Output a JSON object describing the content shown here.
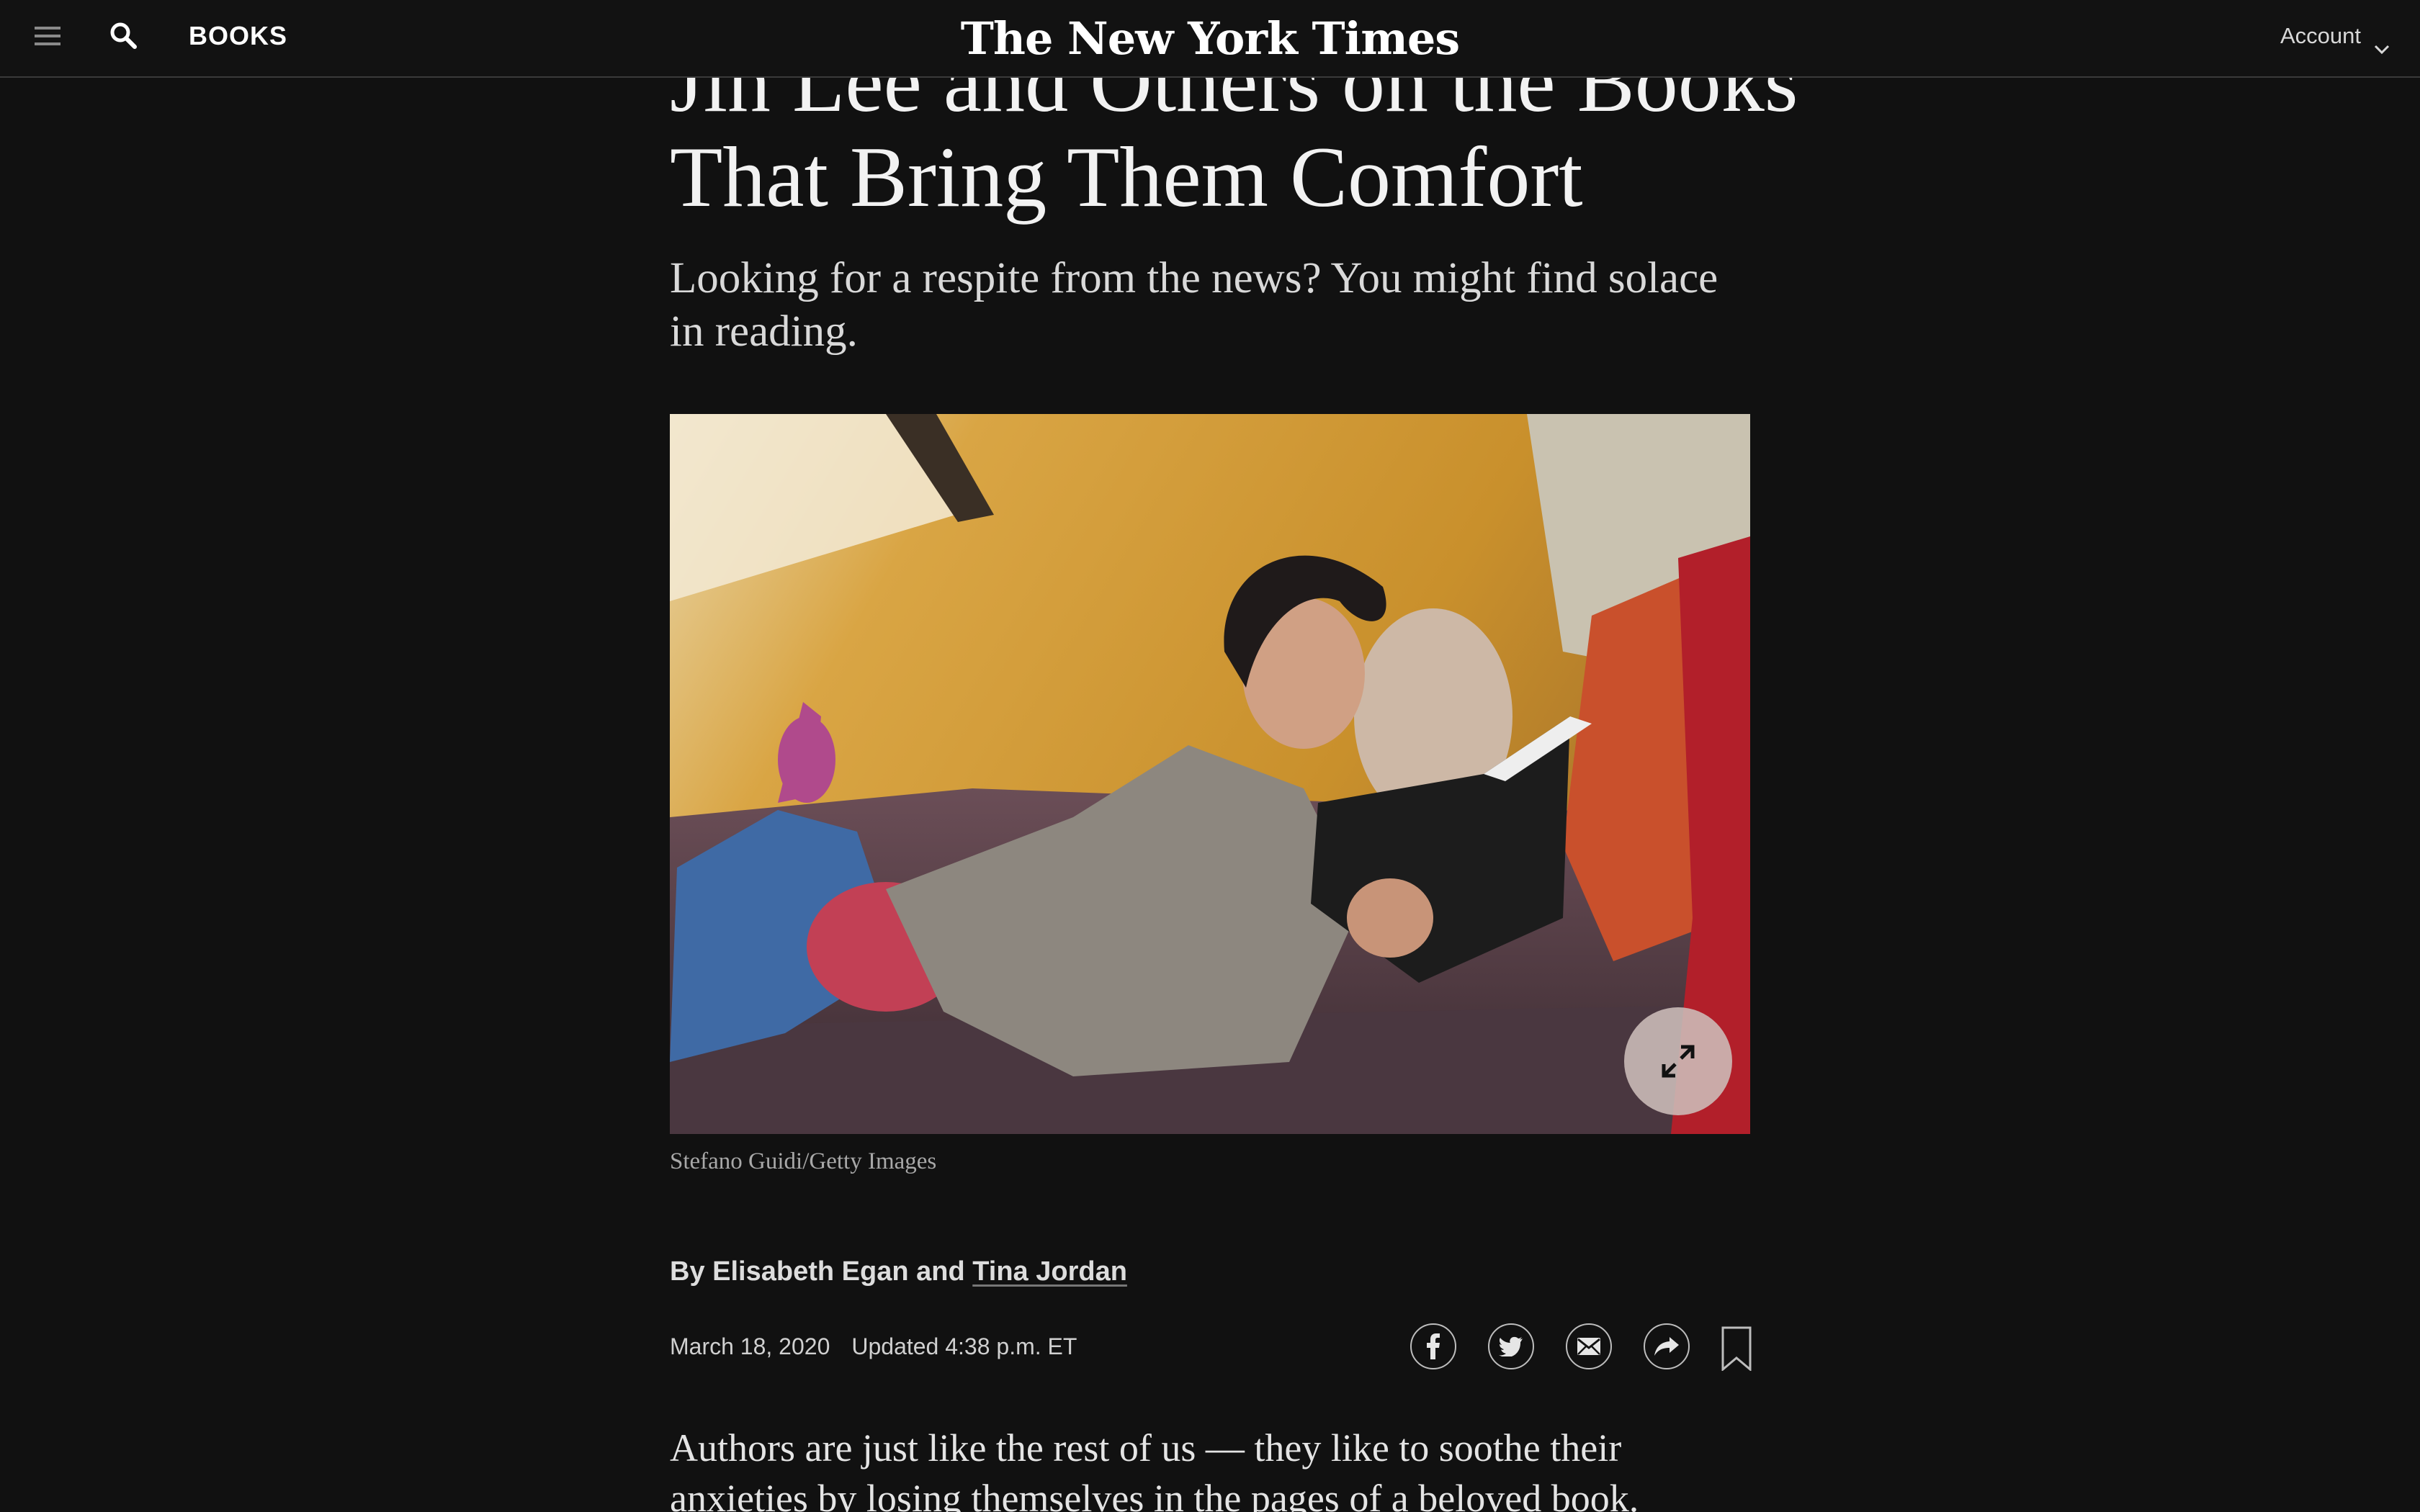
{
  "header": {
    "section": "BOOKS",
    "masthead": "The New York Times",
    "account_label": "Account",
    "icons": {
      "menu": "menu-icon",
      "search": "search-icon",
      "account_dropdown": "chevron-down-icon"
    }
  },
  "article": {
    "headline_line1": "Jin Lee and Others on the Books",
    "headline_line2": "That Bring Them Comfort",
    "summary": "Looking for a respite from the news? You might find solace in reading.",
    "image": {
      "credit": "Stefano Guidi/Getty Images",
      "expand_icon": "expand-icon"
    },
    "byline": {
      "prefix": "By",
      "author1": "Elisabeth Egan",
      "conjunction": "and",
      "author2": "Tina Jordan"
    },
    "date": "March 18, 2020",
    "updated": "Updated 4:38 p.m. ET",
    "share_icons": [
      "facebook-icon",
      "twitter-icon",
      "email-icon",
      "share-icon",
      "bookmark-icon"
    ],
    "body_intro": "Authors are just like the rest of us — they like to soothe their anxieties by losing themselves in the pages of a beloved book."
  },
  "colors": {
    "background": "#111111",
    "text": "#e6e6e6",
    "muted": "#a8a8a8"
  }
}
